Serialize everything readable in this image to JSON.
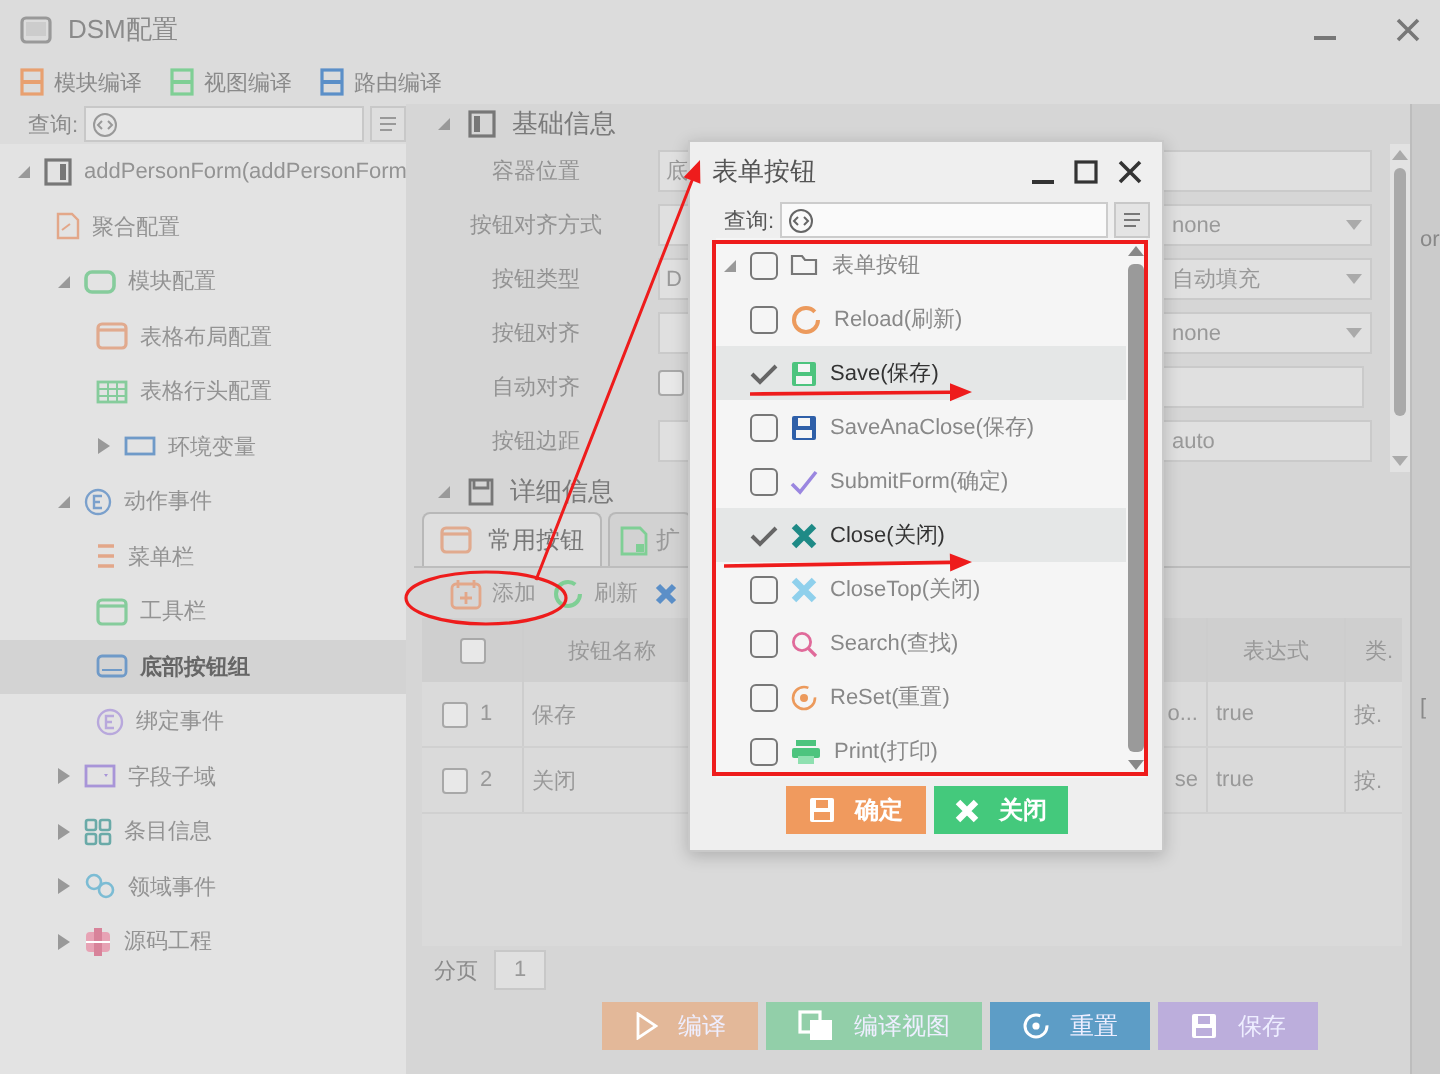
{
  "window": {
    "title": "DSM配置"
  },
  "toolbar": [
    {
      "label": "模块编译"
    },
    {
      "label": "视图编译"
    },
    {
      "label": "路由编译"
    }
  ],
  "sidebar": {
    "search_label": "查询:",
    "tree": [
      {
        "label": "addPersonForm(addPersonForm",
        "expanded": true,
        "selected": false,
        "children": [
          {
            "label": "聚合配置",
            "selected": false
          },
          {
            "label": "模块配置",
            "expanded": true,
            "selected": false,
            "children": [
              {
                "label": "表格布局配置",
                "selected": false
              },
              {
                "label": "表格行头配置",
                "selected": false
              },
              {
                "label": "环境变量",
                "expanded": false,
                "selected": false
              }
            ]
          },
          {
            "label": "动作事件",
            "expanded": true,
            "selected": false,
            "children": [
              {
                "label": "菜单栏",
                "selected": false
              },
              {
                "label": "工具栏",
                "selected": false
              },
              {
                "label": "底部按钮组",
                "selected": true
              },
              {
                "label": "绑定事件",
                "selected": false
              }
            ]
          },
          {
            "label": "字段子域",
            "expanded": false,
            "selected": false
          },
          {
            "label": "条目信息",
            "expanded": false,
            "selected": false
          },
          {
            "label": "领域事件",
            "expanded": false,
            "selected": false
          },
          {
            "label": "源码工程",
            "expanded": false,
            "selected": false
          }
        ]
      }
    ]
  },
  "basic_info": {
    "title": "基础信息",
    "expanded": true,
    "fields": [
      {
        "label": "容器位置",
        "left": {
          "kind": "text",
          "value": "底"
        },
        "right": {
          "kind": "text"
        }
      },
      {
        "label": "按钮对齐方式",
        "left": {
          "kind": "text"
        },
        "right": {
          "kind": "select",
          "value": "none"
        }
      },
      {
        "label": "按钮类型",
        "left": {
          "kind": "text",
          "value": "D"
        },
        "right": {
          "kind": "select",
          "value": "自动填充"
        }
      },
      {
        "label": "按钮对齐",
        "left": {
          "kind": "text"
        },
        "right": {
          "kind": "select",
          "value": "none"
        }
      },
      {
        "label": "自动对齐",
        "left": {
          "kind": "checkbox",
          "checked": false
        },
        "right": {
          "kind": "text"
        }
      },
      {
        "label": "按钮边距",
        "left": {
          "kind": "text"
        },
        "right": {
          "kind": "text",
          "value": "auto"
        }
      }
    ]
  },
  "details": {
    "title": "详细信息",
    "expanded": true,
    "tabs": [
      {
        "label": "常用按钮",
        "selected": true
      },
      {
        "label": "扩",
        "selected": false
      }
    ],
    "actions": [
      {
        "kind": "add",
        "label": "添加"
      },
      {
        "kind": "refresh",
        "label": "刷新"
      },
      {
        "kind": "delete"
      }
    ],
    "table": {
      "header_checked": false,
      "columns": {
        "name": "按钮名称",
        "expression": "表达式",
        "type": "类."
      },
      "rows": [
        {
          "checked": false,
          "index": "1",
          "name": "保存",
          "column_3": "o...",
          "expression": "true",
          "type": "按."
        },
        {
          "checked": false,
          "index": "2",
          "name": "关闭",
          "column_3": "se",
          "expression": "true",
          "type": "按."
        }
      ]
    },
    "pagination": {
      "label": "分页",
      "page": "1"
    }
  },
  "footer_buttons": [
    {
      "kind": "compile",
      "label": "编译",
      "color": "#e3b899"
    },
    {
      "kind": "view",
      "label": "编译视图",
      "color": "#92cfa9"
    },
    {
      "kind": "reset",
      "label": "重置",
      "color": "#5d9dc6"
    },
    {
      "kind": "save",
      "label": "保存",
      "color": "#bcaedc"
    }
  ],
  "right_strip": {
    "texts": [
      "or",
      "["
    ]
  },
  "dialog": {
    "title": "表单按钮",
    "search_label": "查询:",
    "tree": {
      "label": "表单按钮",
      "checked": false,
      "expanded": true,
      "children": [
        {
          "label": "Reload(刷新)",
          "checked": false
        },
        {
          "label": "Save(保存)",
          "checked": true
        },
        {
          "label": "SaveAnaClose(保存)",
          "checked": false
        },
        {
          "label": "SubmitForm(确定)",
          "checked": false
        },
        {
          "label": "Close(关闭)",
          "checked": true
        },
        {
          "label": "CloseTop(关闭)",
          "checked": false
        },
        {
          "label": "Search(查找)",
          "checked": false
        },
        {
          "label": "ReSet(重置)",
          "checked": false
        },
        {
          "label": "Print(打印)",
          "checked": false
        }
      ]
    },
    "buttons": [
      {
        "kind": "ok",
        "label": "确定",
        "color": "#f09a5e"
      },
      {
        "kind": "close",
        "label": "关闭",
        "color": "#44c97c"
      }
    ]
  }
}
